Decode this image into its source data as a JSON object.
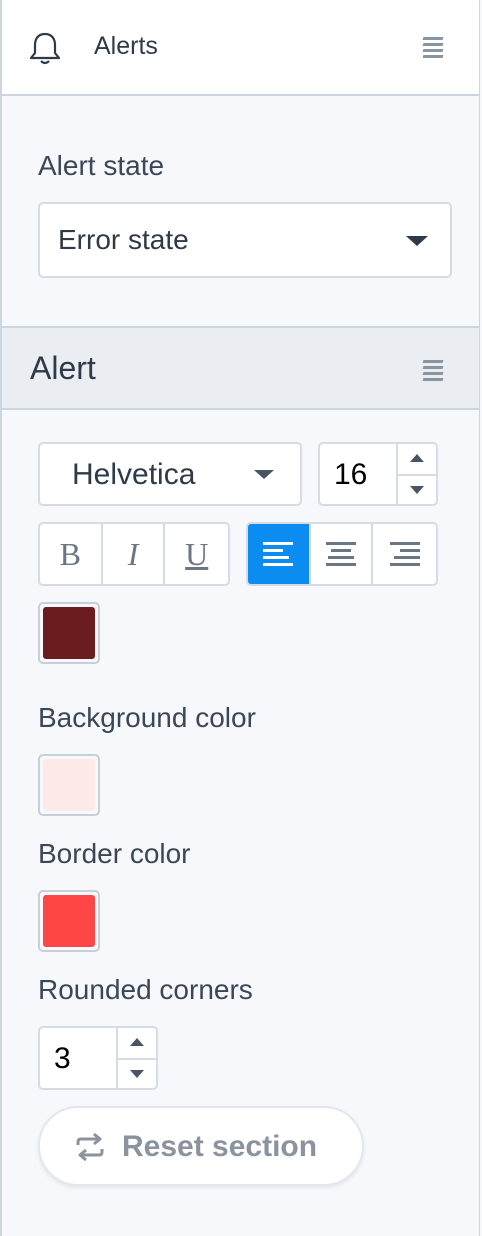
{
  "header": {
    "title": "Alerts",
    "bell_icon": "bell-icon",
    "drag_icon": "drag-handle-icon"
  },
  "alert_state": {
    "label": "Alert state",
    "selected": "Error state"
  },
  "alert_section": {
    "title": "Alert",
    "font": {
      "family": "Helvetica",
      "size": "16"
    },
    "style_buttons": [
      "B",
      "I",
      "U"
    ],
    "align_buttons": [
      "align-left-icon",
      "align-center-icon",
      "align-right-icon"
    ],
    "active_align": "left",
    "text_color": "#6b1c1f",
    "background_color_label": "Background color",
    "background_color": "#ffeaea",
    "border_color_label": "Border color",
    "border_color": "#ff4646",
    "rounded_corners_label": "Rounded corners",
    "rounded_corners": "3",
    "reset_label": "Reset section"
  },
  "colors": {
    "accent": "#0a8cf0"
  }
}
